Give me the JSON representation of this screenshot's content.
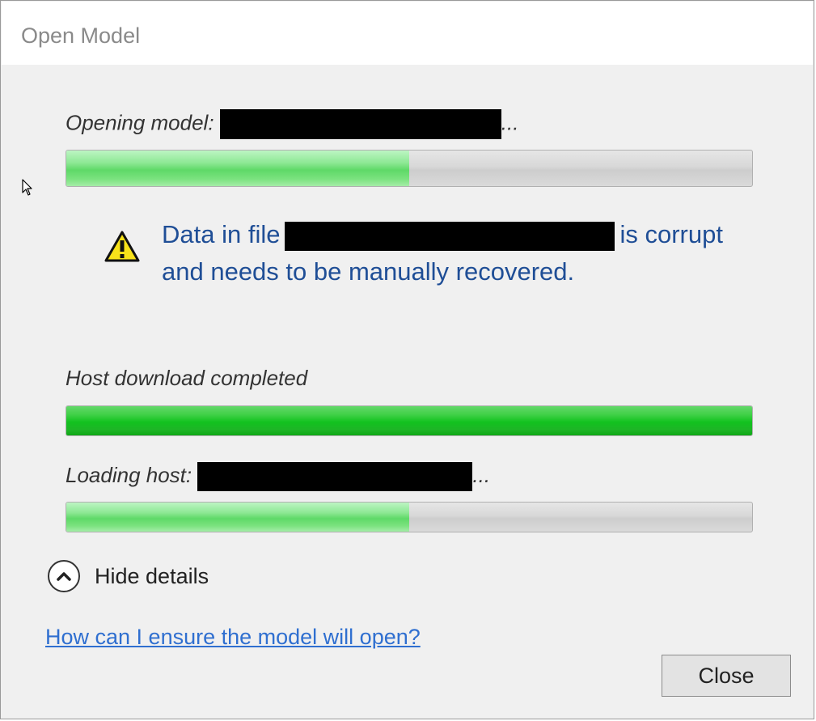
{
  "dialog": {
    "title": "Open Model"
  },
  "opening": {
    "label": "Opening model:",
    "suffix": "...",
    "progress": 0.5
  },
  "warning": {
    "icon": "warning-icon",
    "text_before": "Data in file",
    "text_after": "is corrupt and needs to be manually recovered."
  },
  "host_download": {
    "label": "Host download completed",
    "progress": 1.0
  },
  "loading_host": {
    "label": "Loading host:",
    "suffix": "...",
    "progress": 0.5
  },
  "details_toggle": {
    "label": "Hide details",
    "icon": "chevron-up-icon"
  },
  "help_link": "How can I ensure the model will open?",
  "close_button": "Close",
  "colors": {
    "accent_text": "#1f4e96",
    "link": "#2f6fd0",
    "progress_green": "#12c21f"
  }
}
